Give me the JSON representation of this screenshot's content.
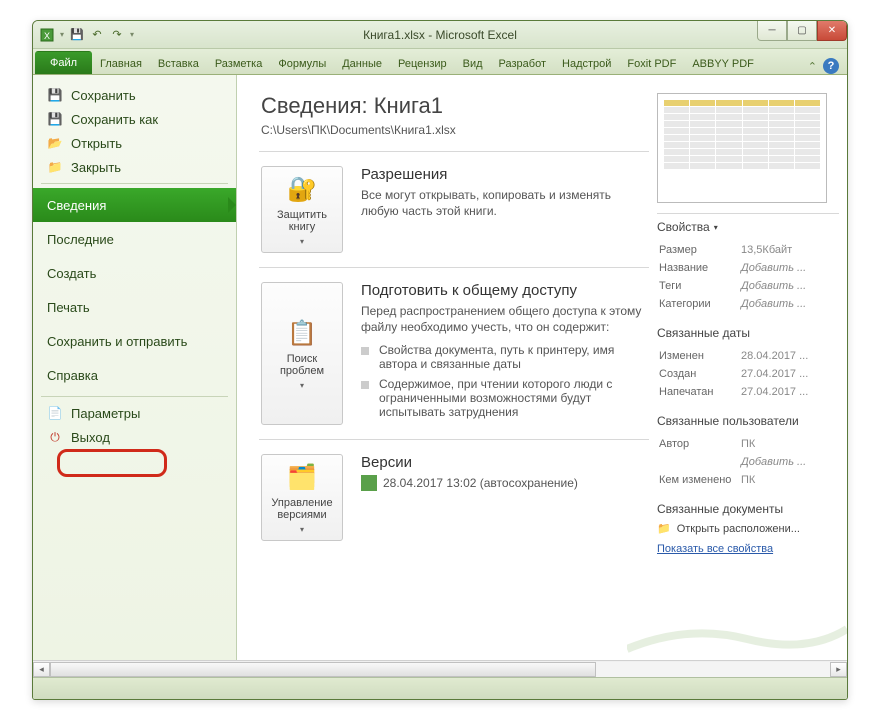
{
  "window": {
    "title": "Книга1.xlsx  -  Microsoft Excel"
  },
  "ribbon": {
    "file": "Файл",
    "tabs": [
      "Главная",
      "Вставка",
      "Разметка",
      "Формулы",
      "Данные",
      "Рецензир",
      "Вид",
      "Разработ",
      "Надстрой",
      "Foxit PDF",
      "ABBYY PDF"
    ]
  },
  "sidebar": {
    "save": "Сохранить",
    "save_as": "Сохранить как",
    "open": "Открыть",
    "close": "Закрыть",
    "info": "Сведения",
    "recent": "Последние",
    "new": "Создать",
    "print": "Печать",
    "share": "Сохранить и отправить",
    "help": "Справка",
    "options": "Параметры",
    "exit": "Выход"
  },
  "info": {
    "heading": "Сведения: Книга1",
    "path": "C:\\Users\\ПК\\Documents\\Книга1.xlsx",
    "permissions": {
      "title": "Разрешения",
      "text": "Все могут открывать, копировать и изменять любую часть этой книги.",
      "button": "Защитить книгу"
    },
    "prepare": {
      "title": "Подготовить к общему доступу",
      "text": "Перед распространением общего доступа к этому файлу необходимо учесть, что он содержит:",
      "bullets": [
        "Свойства документа, путь к принтеру, имя автора и связанные даты",
        "Содержимое, при чтении которого люди с ограниченными возможностями будут испытывать затруднения"
      ],
      "button": "Поиск проблем"
    },
    "versions": {
      "title": "Версии",
      "line": "28.04.2017 13:02 (автосохранение)",
      "button": "Управление версиями"
    }
  },
  "props": {
    "header": "Свойства",
    "size_l": "Размер",
    "size_v": "13,5Кбайт",
    "title_l": "Название",
    "title_v": "Добавить ...",
    "tags_l": "Теги",
    "tags_v": "Добавить ...",
    "cat_l": "Категории",
    "cat_v": "Добавить ...",
    "dates_header": "Связанные даты",
    "mod_l": "Изменен",
    "mod_v": "28.04.2017 ...",
    "created_l": "Создан",
    "created_v": "27.04.2017 ...",
    "printed_l": "Напечатан",
    "printed_v": "27.04.2017 ...",
    "people_header": "Связанные пользователи",
    "author_l": "Автор",
    "author_v": "ПК",
    "author_add": "Добавить ...",
    "lastmod_l": "Кем изменено",
    "lastmod_v": "ПК",
    "docs_header": "Связанные документы",
    "open_loc": "Открыть расположени...",
    "show_all": "Показать все свойства"
  }
}
